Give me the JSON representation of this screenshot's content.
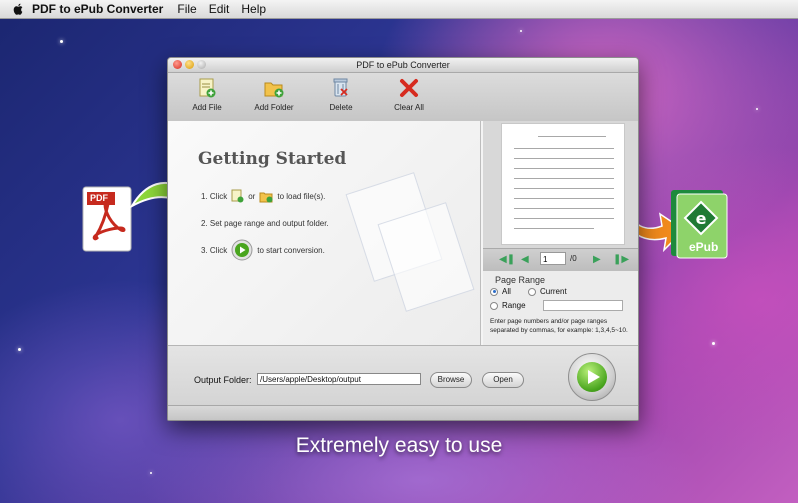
{
  "menubar": {
    "app_name": "PDF to ePub Converter",
    "items": [
      "File",
      "Edit",
      "Help"
    ]
  },
  "window": {
    "title": "PDF to ePub Converter"
  },
  "toolbar": {
    "add_file": "Add File",
    "add_folder": "Add Folder",
    "delete": "Delete",
    "clear_all": "Clear All"
  },
  "getting_started": {
    "title": "Getting Started",
    "step1_prefix": "1. Click",
    "step1_or": "or",
    "step1_suffix": "to load file(s).",
    "step2": "2. Set page range and output folder.",
    "step3_prefix": "3. Click",
    "step3_suffix": "to start conversion."
  },
  "preview": {
    "page_value": "1",
    "page_total": "/0"
  },
  "page_range": {
    "title": "Page Range",
    "all": "All",
    "current": "Current",
    "range": "Range",
    "selected": "All",
    "help": "Enter page numbers and/or page ranges separated by commas, for example: 1,3,4,5~10."
  },
  "output": {
    "label": "Output Folder:",
    "path": "/Users/apple/Desktop/output",
    "browse": "Browse",
    "open": "Open"
  },
  "caption": "Extremely easy to use",
  "epub_icon_text": "ePub",
  "pdf_icon_text": "PDF",
  "colors": {
    "accent_green": "#49a51e",
    "arrow_orange": "#f08a1c",
    "clear_red": "#d62b1f"
  }
}
